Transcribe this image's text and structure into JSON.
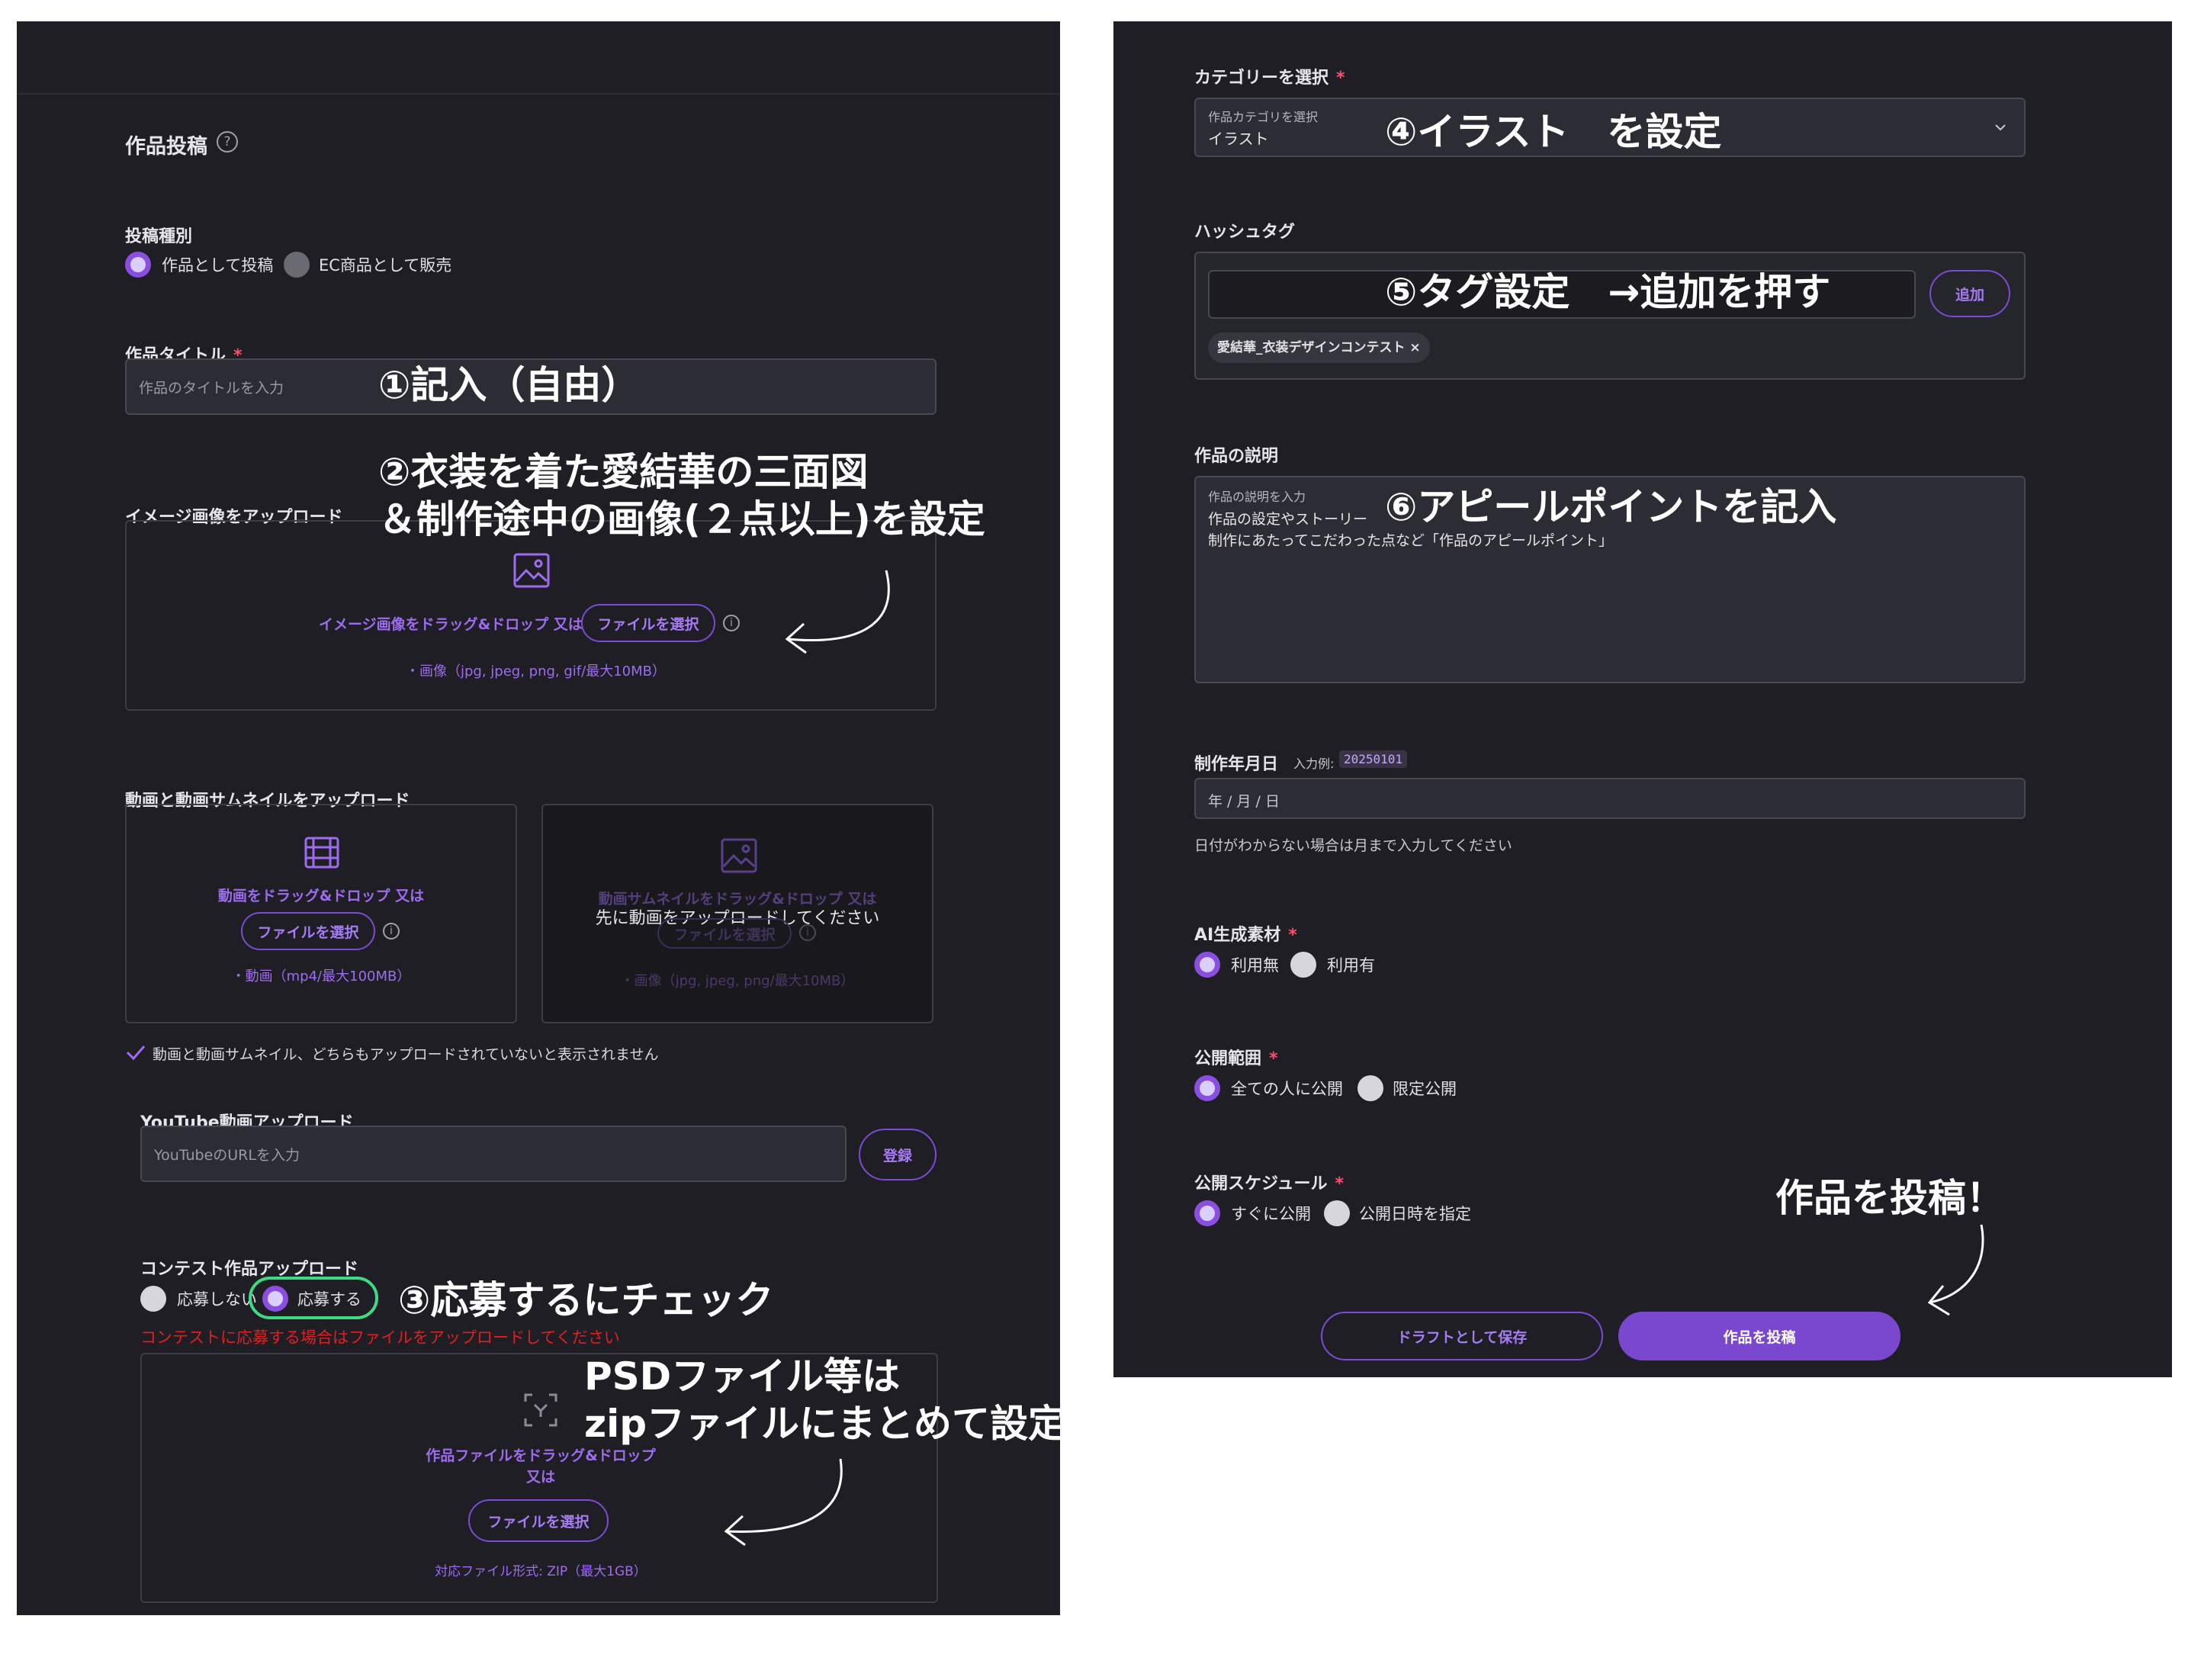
{
  "left": {
    "title": "作品投稿",
    "post_type": {
      "label": "投稿種別",
      "options": [
        "作品として投稿",
        "EC商品として販売"
      ]
    },
    "work_title": {
      "label": "作品タイトル",
      "required": "*",
      "placeholder": "作品のタイトルを入力"
    },
    "image_upload": {
      "label": "イメージ画像をアップロード",
      "drop_text": "イメージ画像をドラッグ&ドロップ 又は",
      "button": "ファイルを選択",
      "note": "・画像（jpg, jpeg, png, gif/最大10MB）"
    },
    "video_upload": {
      "label": "動画と動画サムネイルをアップロード",
      "video_drop": "動画をドラッグ&ドロップ 又は",
      "video_button": "ファイルを選択",
      "video_note": "・動画（mp4/最大100MB）",
      "thumb_drop": "動画サムネイルをドラッグ&ドロップ 又は",
      "thumb_overlay": "先に動画をアップロードしてください",
      "thumb_button": "ファイルを選択",
      "thumb_note": "・画像（jpg, jpeg, png/最大10MB）",
      "notice": "動画と動画サムネイル、どちらもアップロードされていないと表示されません"
    },
    "youtube": {
      "label": "YouTube動画アップロード",
      "placeholder": "YouTubeのURLを入力",
      "button": "登録"
    },
    "contest": {
      "label": "コンテスト作品アップロード",
      "options": [
        "応募しない",
        "応募する"
      ],
      "warning": "コンテストに応募する場合はファイルをアップロードしてください",
      "drop_line1": "作品ファイルをドラッグ&ドロップ",
      "drop_line2": "又は",
      "button": "ファイルを選択",
      "note": "対応ファイル形式: ZIP（最大1GB）"
    }
  },
  "right": {
    "category": {
      "label": "カテゴリーを選択",
      "required": "*",
      "floating": "作品カテゴリを選択",
      "value": "イラスト"
    },
    "hashtag": {
      "label": "ハッシュタグ",
      "add_button": "追加",
      "tags": [
        "愛結華_衣装デザインコンテスト ×"
      ]
    },
    "description": {
      "label": "作品の説明",
      "floating": "作品の説明を入力",
      "line1": "作品の設定やストーリー",
      "line2": "制作にあたってこだわった点など「作品のアピールポイント」"
    },
    "date": {
      "label": "制作年月日",
      "example_label": "入力例:",
      "example": "20250101",
      "placeholder": "年 / 月 / 日",
      "help": "日付がわからない場合は月まで入力してください"
    },
    "ai": {
      "label": "AI生成素材",
      "required": "*",
      "options": [
        "利用無",
        "利用有"
      ]
    },
    "visibility": {
      "label": "公開範囲",
      "required": "*",
      "options": [
        "全ての人に公開",
        "限定公開"
      ]
    },
    "schedule": {
      "label": "公開スケジュール",
      "required": "*",
      "options": [
        "すぐに公開",
        "公開日時を指定"
      ]
    },
    "buttons": {
      "draft": "ドラフトとして保存",
      "post": "作品を投稿"
    }
  },
  "annotations": {
    "a1": "①記入（自由）",
    "a2_line1": "②衣装を着た愛結華の三面図",
    "a2_line2": "＆制作途中の画像(２点以上)を設定",
    "a3": "③応募するにチェック",
    "a4": "④イラスト　を設定",
    "a5": "⑤タグ設定　→追加を押す",
    "a6": "⑥アピールポイントを記入",
    "psd_line1": "PSDファイル等は",
    "psd_line2": "zipファイルにまとめて設定",
    "submit": "作品を投稿！"
  },
  "colors": {
    "panel": "#1e1e24",
    "accent": "#8a4fe0",
    "accent_text": "#9d6cf0",
    "highlight": "#3ddc84",
    "warning": "#e02020"
  }
}
